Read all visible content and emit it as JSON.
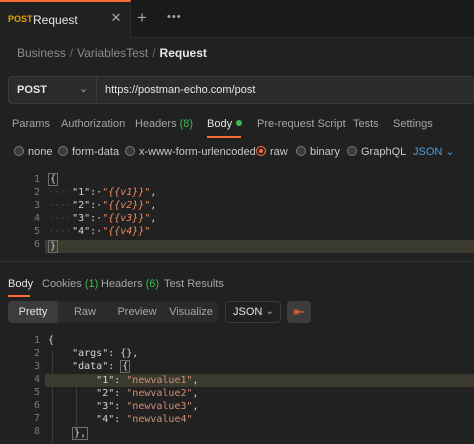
{
  "tab": {
    "method": "POST",
    "title": "Request",
    "close": "✕",
    "new": "+",
    "more": "•••"
  },
  "breadcrumb": {
    "items": [
      "Business",
      "VariablesTest"
    ],
    "current": "Request",
    "separator": "/"
  },
  "request": {
    "method": "POST",
    "url": "https://postman-echo.com/post"
  },
  "request_tabs": [
    {
      "label": "Params"
    },
    {
      "label": "Authorization"
    },
    {
      "label": "Headers",
      "count": "(8)"
    },
    {
      "label": "Body"
    },
    {
      "label": "Pre-request Script"
    },
    {
      "label": "Tests"
    },
    {
      "label": "Settings"
    }
  ],
  "body_types": {
    "options": [
      "none",
      "form-data",
      "x-www-form-urlencoded",
      "raw",
      "binary",
      "GraphQL"
    ],
    "selected": "raw",
    "format": "JSON"
  },
  "request_body": {
    "line_numbers": [
      "1",
      "2",
      "3",
      "4",
      "5",
      "6"
    ],
    "open": "{",
    "close": "}",
    "entries": [
      {
        "key": "\"1\"",
        "value": "\"{{v1}}\"",
        "sep": ","
      },
      {
        "key": "\"2\"",
        "value": "\"{{v2}}\"",
        "sep": ","
      },
      {
        "key": "\"3\"",
        "value": "\"{{v3}}\"",
        "sep": ","
      },
      {
        "key": "\"4\"",
        "value": "\"{{v4}}\"",
        "sep": ""
      }
    ]
  },
  "response_tabs": [
    {
      "label": "Body"
    },
    {
      "label": "Cookies",
      "count": "(1)"
    },
    {
      "label": "Headers",
      "count": "(6)"
    },
    {
      "label": "Test Results"
    }
  ],
  "view_modes": [
    "Pretty",
    "Raw",
    "Preview",
    "Visualize"
  ],
  "response_format": "JSON",
  "response_body": {
    "line_numbers": [
      "1",
      "2",
      "3",
      "4",
      "5",
      "6",
      "7",
      "8"
    ],
    "open": "{",
    "args_key": "\"args\"",
    "args_value": "{},",
    "data_key": "\"data\"",
    "data_open": "{",
    "entries": [
      {
        "key": "\"1\"",
        "value": "\"newvalue1\"",
        "sep": ","
      },
      {
        "key": "\"2\"",
        "value": "\"newvalue2\"",
        "sep": ","
      },
      {
        "key": "\"3\"",
        "value": "\"newvalue3\"",
        "sep": ","
      },
      {
        "key": "\"4\"",
        "value": "\"newvalue4\"",
        "sep": ""
      }
    ],
    "data_close": "},"
  }
}
